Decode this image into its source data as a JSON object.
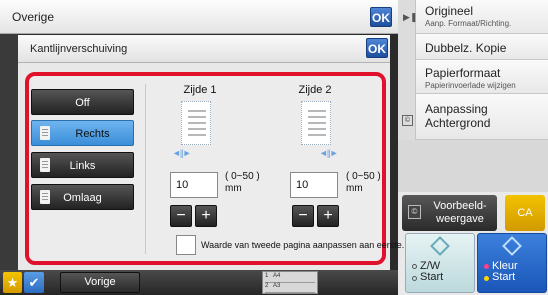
{
  "topbar": {
    "title": "Overige",
    "ok": "OK"
  },
  "dialog": {
    "title": "Kantlijnverschuiving",
    "ok": "OK"
  },
  "options": [
    "Off",
    "Rechts",
    "Links",
    "Omlaag"
  ],
  "selected_option": "Rechts",
  "side1": {
    "label": "Zijde 1",
    "value": "10",
    "range": "( 0~50 )",
    "unit": "mm"
  },
  "side2": {
    "label": "Zijde 2",
    "value": "10",
    "range": "( 0~50 )",
    "unit": "mm"
  },
  "stepper": {
    "minus": "−",
    "plus": "+"
  },
  "checkbox_label": "Waarde van tweede pagina aanpassen aan eerste.",
  "right_menu": [
    {
      "title": "Origineel",
      "subtitle": "Aanp. Formaat/Richting."
    },
    {
      "title": "Dubbelz. Kopie",
      "subtitle": ""
    },
    {
      "title": "Papierformaat",
      "subtitle": "Papierinvoerlade wijzigen"
    },
    {
      "title": "Aanpassing Achtergrond",
      "subtitle": ""
    }
  ],
  "preview": {
    "line1": "Voorbeeld-",
    "line2": "weergave"
  },
  "ca": "CA",
  "start_bw": {
    "line1": "Z/W",
    "line2": "Start"
  },
  "start_color": {
    "line1": "Kleur",
    "line2": "Start"
  },
  "bottom": {
    "back": "Vorige"
  },
  "trays": [
    {
      "num": "1",
      "size": "A4"
    },
    {
      "num": "2",
      "size": "A3"
    }
  ],
  "colors": {
    "accent_red": "#e0112b",
    "selected_blue": "#4a9ae0",
    "ok_blue": "#1d4e9e",
    "ca_yellow": "#e3ad00"
  }
}
